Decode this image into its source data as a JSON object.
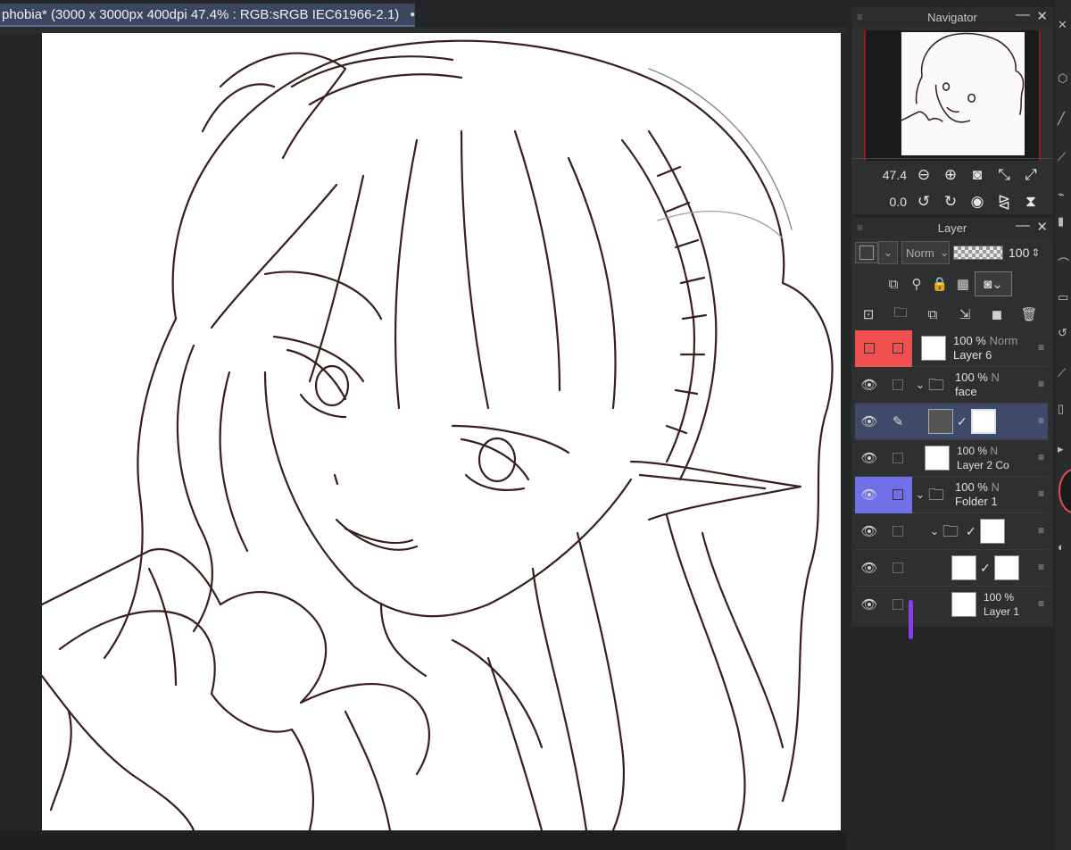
{
  "document": {
    "tab_title": "phobia* (3000 x 3000px 400dpi 47.4% : RGB:sRGB IEC61966-2.1)",
    "modified_dot": "●"
  },
  "navigator": {
    "title": "Navigator",
    "zoom_value": "47.4",
    "rotation_value": "0.0",
    "icons": [
      "zoom-out-icon",
      "zoom-in-icon",
      "fit-icon",
      "fit-window-icon",
      "actual-size-icon",
      "rotate-left-icon",
      "rotate-right-icon",
      "reset-rotation-icon",
      "flip-horizontal-icon",
      "flip-vertical-icon"
    ]
  },
  "layer_panel": {
    "title": "Layer",
    "blend_mode": "Norm",
    "opacity": "100",
    "layers": [
      {
        "pct": "100 %",
        "mode": "Norm",
        "name": "Layer 6",
        "eye": "",
        "color": "red",
        "type": "layer"
      },
      {
        "pct": "100 %",
        "mode": "N",
        "name": "face",
        "eye": "👁",
        "color": "",
        "type": "folder"
      },
      {
        "pct": "",
        "mode": "",
        "name": "",
        "eye": "👁",
        "color": "",
        "type": "mask",
        "selected": true
      },
      {
        "pct": "100 %",
        "mode": "N",
        "name": "Layer 2 Co",
        "eye": "👁",
        "color": "",
        "type": "layer"
      },
      {
        "pct": "100 %",
        "mode": "N",
        "name": "Folder 1",
        "eye": "👁",
        "color": "blue",
        "type": "folder"
      },
      {
        "pct": "",
        "mode": "",
        "name": "",
        "eye": "👁",
        "color": "",
        "type": "subfolder"
      },
      {
        "pct": "",
        "mode": "",
        "name": "",
        "eye": "👁",
        "color": "",
        "type": "clip"
      },
      {
        "pct": "100 %",
        "mode": "",
        "name": "Layer 1",
        "eye": "👁",
        "color": "",
        "type": "layer"
      }
    ]
  },
  "colors": {
    "tab_bg": "#3c4660",
    "selected_layer": "#3f4a68",
    "red_label": "#f05050",
    "blue_label": "#7070e8",
    "line_art": "#3a1e1e"
  }
}
